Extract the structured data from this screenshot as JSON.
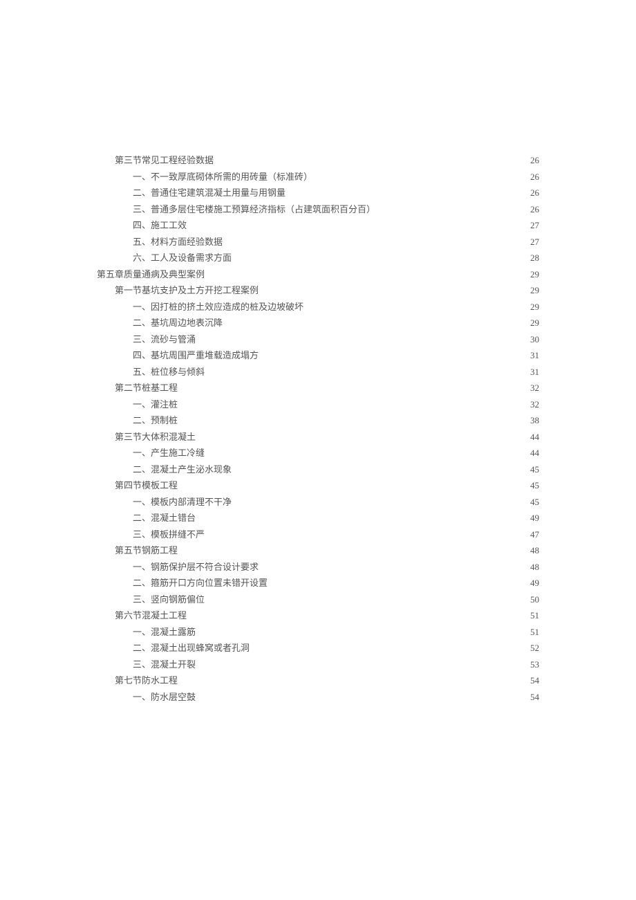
{
  "toc": [
    {
      "indent": 1,
      "label": "第三节常见工程经验数据",
      "page": "26"
    },
    {
      "indent": 2,
      "label": "一、不一致厚底砌体所需的用砖量（标准砖）",
      "page": "26"
    },
    {
      "indent": 2,
      "label": "二、普通住宅建筑混凝土用量与用钢量",
      "page": "26"
    },
    {
      "indent": 2,
      "label": "三、普通多层住宅楼施工预算经济指标（占建筑面积百分百）",
      "page": "26"
    },
    {
      "indent": 2,
      "label": "四、施工工效",
      "page": "27"
    },
    {
      "indent": 2,
      "label": "五、材料方面经验数据",
      "page": "27"
    },
    {
      "indent": 2,
      "label": "六、工人及设备需求方面",
      "page": "28"
    },
    {
      "indent": 0,
      "label": "第五章质量通病及典型案例",
      "page": "29"
    },
    {
      "indent": 1,
      "label": "第一节基坑支护及土方开挖工程案例",
      "page": "29"
    },
    {
      "indent": 2,
      "label": "一、因打桩的挤土效应造成的桩及边坡破坏",
      "page": "29"
    },
    {
      "indent": 2,
      "label": "二、基坑周边地表沉降",
      "page": "29"
    },
    {
      "indent": 2,
      "label": "三、流砂与管涌",
      "page": "30"
    },
    {
      "indent": 2,
      "label": "四、基坑周围严重堆载造成塌方",
      "page": "31"
    },
    {
      "indent": 2,
      "label": "五、桩位移与倾斜",
      "page": "31"
    },
    {
      "indent": 1,
      "label": "第二节桩基工程",
      "page": "32"
    },
    {
      "indent": 2,
      "label": "一、灌注桩",
      "page": "32"
    },
    {
      "indent": 2,
      "label": "二、预制桩",
      "page": "38"
    },
    {
      "indent": 1,
      "label": "第三节大体积混凝土",
      "page": "44"
    },
    {
      "indent": 2,
      "label": "一、产生施工冷缝",
      "page": "44"
    },
    {
      "indent": 2,
      "label": "二、混凝土产生泌水现象",
      "page": "45"
    },
    {
      "indent": 1,
      "label": "第四节模板工程",
      "page": "45"
    },
    {
      "indent": 2,
      "label": "一、模板内部清理不干净",
      "page": "45"
    },
    {
      "indent": 2,
      "label": "二、混凝土错台",
      "page": "49"
    },
    {
      "indent": 2,
      "label": "三、模板拼缝不严",
      "page": "47"
    },
    {
      "indent": 1,
      "label": "第五节钢筋工程",
      "page": "48"
    },
    {
      "indent": 2,
      "label": "一、钢筋保护层不符合设计要求",
      "page": "48"
    },
    {
      "indent": 2,
      "label": "二、箍筋开口方向位置未错开设置",
      "page": "49"
    },
    {
      "indent": 2,
      "label": "三、竖向钢筋偏位",
      "page": "50"
    },
    {
      "indent": 1,
      "label": "第六节混凝土工程",
      "page": "51"
    },
    {
      "indent": 2,
      "label": "一、混凝土露筋",
      "page": "51"
    },
    {
      "indent": 2,
      "label": "二、混凝土出现蜂窝或者孔洞",
      "page": "52"
    },
    {
      "indent": 2,
      "label": "三、混凝土开裂",
      "page": "53"
    },
    {
      "indent": 1,
      "label": "第七节防水工程",
      "page": "54"
    },
    {
      "indent": 2,
      "label": "一、防水层空鼓",
      "page": "54"
    }
  ]
}
